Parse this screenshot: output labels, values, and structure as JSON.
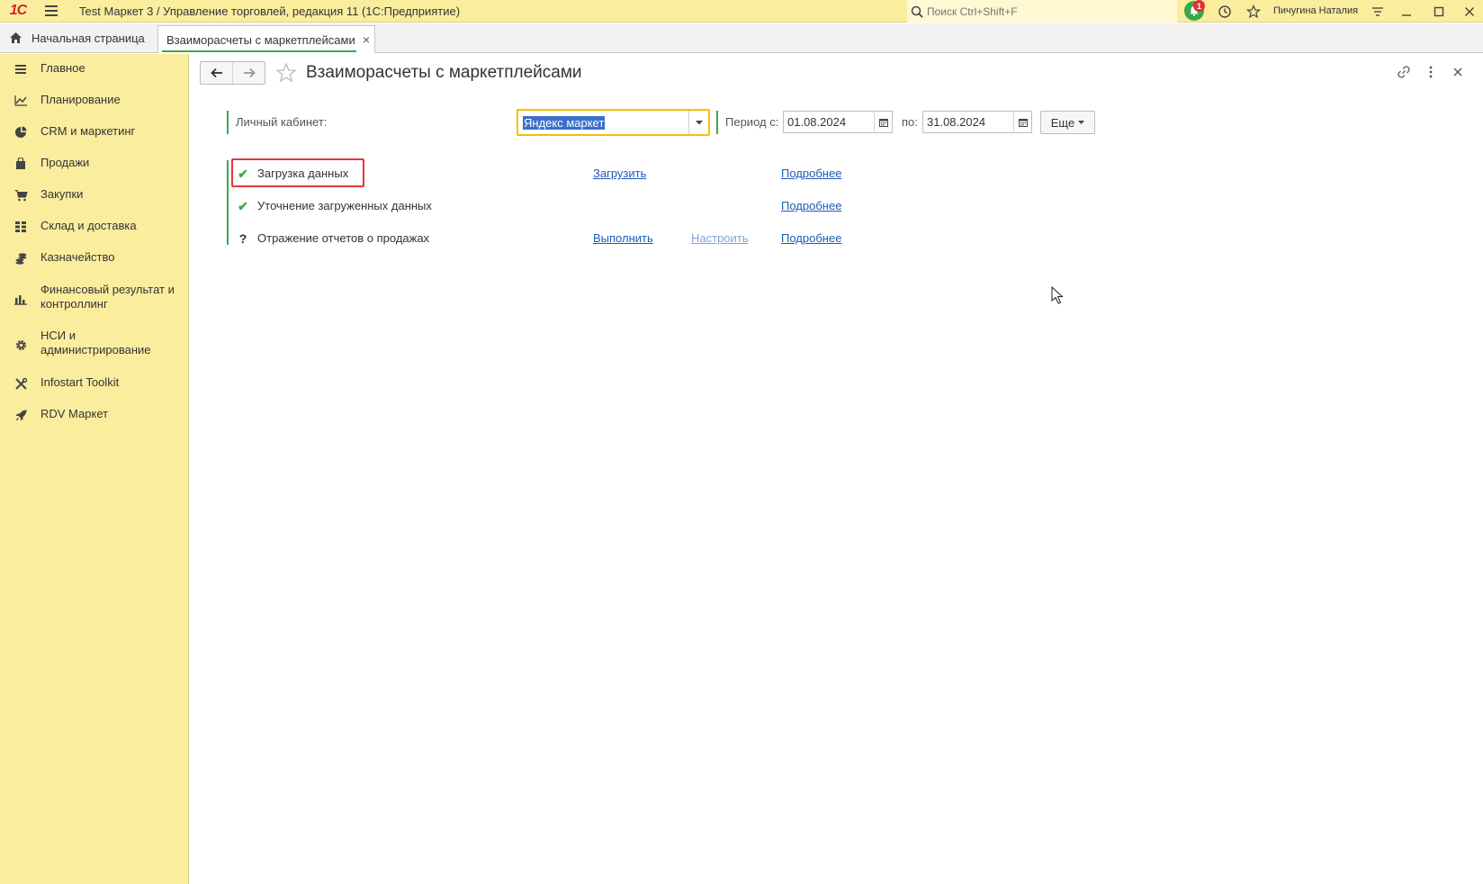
{
  "app": {
    "logo_text": "1С",
    "title": "Test Маркет 3 / Управление торговлей, редакция 11  (1С:Предприятие)",
    "search_placeholder": "Поиск Ctrl+Shift+F",
    "notification_count": "1",
    "user_name": "Пичугина Наталия"
  },
  "tabs": {
    "home_label": "Начальная страница",
    "active_label": "Взаиморасчеты с маркетплейсами",
    "close_glyph": "×"
  },
  "sidebar": {
    "items": [
      {
        "label": "Главное",
        "icon": "list-icon"
      },
      {
        "label": "Планирование",
        "icon": "planning-icon"
      },
      {
        "label": "CRM и маркетинг",
        "icon": "pie-icon"
      },
      {
        "label": "Продажи",
        "icon": "bag-icon"
      },
      {
        "label": "Закупки",
        "icon": "cart-icon"
      },
      {
        "label": "Склад и доставка",
        "icon": "grid-icon"
      },
      {
        "label": "Казначейство",
        "icon": "coins-icon"
      },
      {
        "label": "Финансовый результат и контроллинг",
        "icon": "bar-chart-icon"
      },
      {
        "label": "НСИ и администрирование",
        "icon": "gear-icon"
      },
      {
        "label": "Infostart Toolkit",
        "icon": "tools-icon"
      },
      {
        "label": "RDV Маркет",
        "icon": "rocket-icon"
      }
    ]
  },
  "form": {
    "title": "Взаиморасчеты с маркетплейсами",
    "cabinet_label": "Личный кабинет:",
    "cabinet_value": "Яндекс маркет",
    "period_from_label": "Период с:",
    "period_from_value": "01.08.2024",
    "period_to_label": "по:",
    "period_to_value": "31.08.2024",
    "more_label": "Еще"
  },
  "steps": [
    {
      "status": "done",
      "status_glyph": "✔",
      "label": "Загрузка данных",
      "action": "Загрузить",
      "setup": "",
      "details": "Подробнее"
    },
    {
      "status": "done",
      "status_glyph": "✔",
      "label": "Уточнение загруженных данных",
      "action": "",
      "setup": "",
      "details": "Подробнее"
    },
    {
      "status": "unknown",
      "status_glyph": "?",
      "label": "Отражение отчетов о продажах",
      "action": "Выполнить",
      "setup": "Настроить",
      "details": "Подробнее"
    }
  ],
  "colors": {
    "sidebar_bg": "#fbed9e",
    "accent_green": "#3aa84a",
    "link_blue": "#1e5bb8",
    "highlight_red": "#e0383e",
    "focus_yellow": "#f5c000"
  }
}
